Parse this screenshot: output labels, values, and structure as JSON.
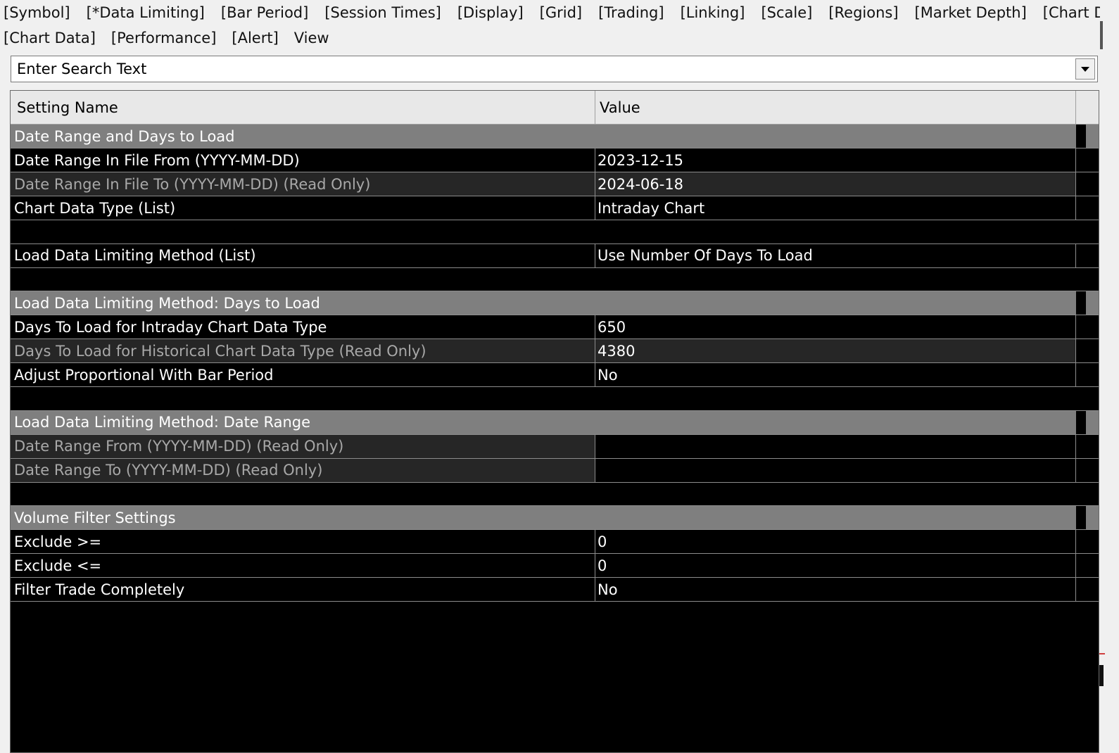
{
  "tabs_row1": [
    {
      "label": "[Symbol]"
    },
    {
      "label": "[*Data Limiting]"
    },
    {
      "label": "[Bar Period]"
    },
    {
      "label": "[Session Times]"
    },
    {
      "label": "[Display]"
    },
    {
      "label": "[Grid]"
    },
    {
      "label": "[Trading]"
    },
    {
      "label": "[Linking]"
    },
    {
      "label": "[Scale]"
    },
    {
      "label": "[Regions]"
    },
    {
      "label": "[Market Depth]"
    },
    {
      "label": "[Chart Drawings]"
    }
  ],
  "tabs_row2": [
    {
      "label": "[Chart Data]"
    },
    {
      "label": "[Performance]"
    },
    {
      "label": "[Alert]"
    },
    {
      "label": "View"
    }
  ],
  "search": {
    "placeholder": "Enter Search Text"
  },
  "grid": {
    "header_name": "Setting Name",
    "header_value": "Value",
    "rows": [
      {
        "kind": "section",
        "name": "Date Range and Days to Load"
      },
      {
        "kind": "setting",
        "name": "Date Range In File From (YYYY-MM-DD)",
        "value": "2023-12-15",
        "readonly": false
      },
      {
        "kind": "setting",
        "name": "Date Range In File To (YYYY-MM-DD) (Read Only)",
        "value": "2024-06-18",
        "readonly": true
      },
      {
        "kind": "setting",
        "name": "Chart Data Type (List)",
        "value": "Intraday Chart",
        "readonly": false
      },
      {
        "kind": "blank"
      },
      {
        "kind": "setting",
        "name": "Load Data Limiting Method (List)",
        "value": "Use Number Of Days To Load",
        "readonly": false
      },
      {
        "kind": "blank"
      },
      {
        "kind": "section",
        "name": "Load Data Limiting Method: Days to Load"
      },
      {
        "kind": "setting",
        "name": "Days To Load for Intraday Chart Data Type",
        "value": "650",
        "readonly": false
      },
      {
        "kind": "setting",
        "name": "Days To Load for Historical Chart Data Type (Read Only)",
        "value": "4380",
        "readonly": true
      },
      {
        "kind": "setting",
        "name": "Adjust Proportional With Bar Period",
        "value": "No",
        "readonly": false
      },
      {
        "kind": "blank"
      },
      {
        "kind": "section",
        "name": "Load Data Limiting Method: Date Range"
      },
      {
        "kind": "setting",
        "name": "Date Range From (YYYY-MM-DD) (Read Only)",
        "value": "",
        "readonly": true
      },
      {
        "kind": "setting",
        "name": "Date Range To (YYYY-MM-DD) (Read Only)",
        "value": "",
        "readonly": true
      },
      {
        "kind": "blank"
      },
      {
        "kind": "section",
        "name": "Volume Filter Settings"
      },
      {
        "kind": "setting",
        "name": "Exclude >=",
        "value": "0",
        "readonly": false
      },
      {
        "kind": "setting",
        "name": "Exclude <=",
        "value": "0",
        "readonly": false
      },
      {
        "kind": "setting",
        "name": "Filter Trade Completely",
        "value": "No",
        "readonly": false
      }
    ]
  },
  "colors": {
    "grid_background": "#000000",
    "section_background": "#7f7f7f",
    "readonly_background": "#262626",
    "readonly_text": "#a8a8a8",
    "text": "#ffffff"
  },
  "icons": {
    "dropdown": "chevron-down-icon"
  }
}
